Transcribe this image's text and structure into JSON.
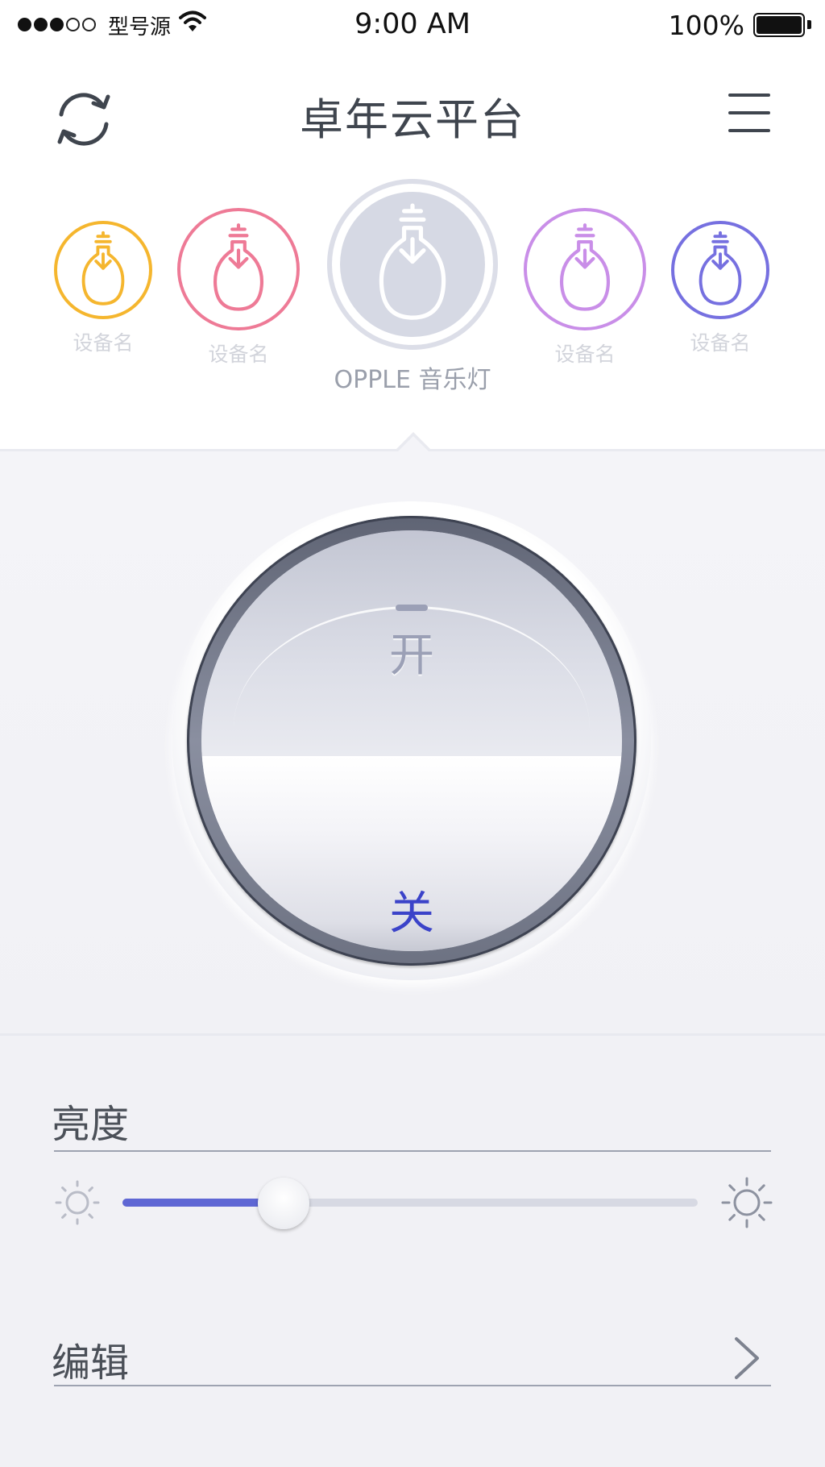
{
  "status_bar": {
    "carrier": "型号源",
    "time": "9:00 AM",
    "battery": "100%",
    "signal_bars_filled": 3,
    "signal_bars_total": 5
  },
  "nav": {
    "title": "卓年云平台",
    "left_icon": "refresh-icon",
    "right_icon": "menu-icon"
  },
  "devices": [
    {
      "name": "设备名",
      "color": "#f5b62e",
      "icon": "bulb-icon"
    },
    {
      "name": "设备名",
      "color": "#ee7a96",
      "icon": "bulb-icon"
    },
    {
      "name": "OPPLE 音乐灯",
      "color": "#ffffff",
      "icon": "bulb-icon",
      "active": true
    },
    {
      "name": "设备名",
      "color": "#c98ee8",
      "icon": "bulb-icon"
    },
    {
      "name": "设备名",
      "color": "#7670e0",
      "icon": "bulb-icon"
    }
  ],
  "power_switch": {
    "on_label": "开",
    "off_label": "关",
    "state": "off",
    "active_color": "#3b43c9"
  },
  "brightness": {
    "label": "亮度",
    "value_fraction": 0.28,
    "accent": "#5f67d4"
  },
  "edit": {
    "label": "编辑"
  }
}
